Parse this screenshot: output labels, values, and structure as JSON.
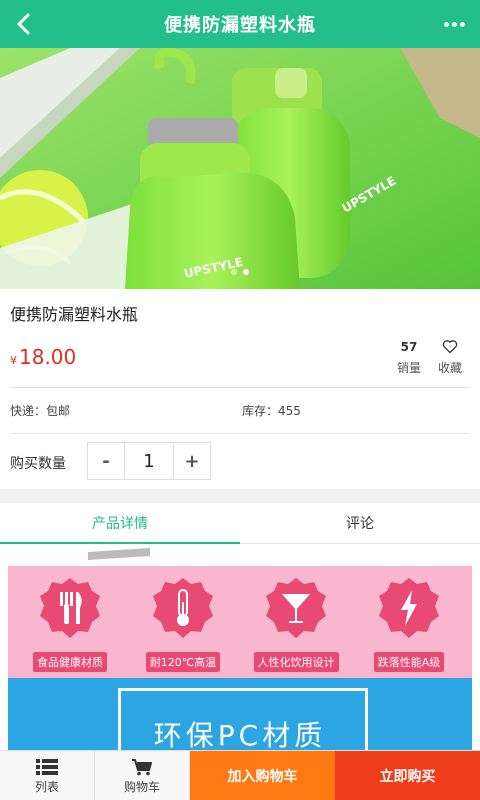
{
  "header": {
    "title": "便携防漏塑料水瓶"
  },
  "hero": {
    "bottle_text": "UPSTYLE",
    "slide_count": 2,
    "active_slide": 2
  },
  "product": {
    "name": "便携防漏塑料水瓶",
    "currency": "¥",
    "price": "18.00",
    "sales_count": "57",
    "sales_label": "销量",
    "favorite_label": "收藏",
    "shipping": "快递：包邮",
    "stock": "库存：455",
    "quantity_label": "购买数量",
    "quantity": "1",
    "minus": "-",
    "plus": "+"
  },
  "tabs": [
    {
      "label": "产品详情",
      "active": true
    },
    {
      "label": "评论",
      "active": false
    }
  ],
  "detail": {
    "features": [
      {
        "icon": "utensils-icon",
        "caption": "食品健康材质"
      },
      {
        "icon": "thermometer-icon",
        "caption": "耐120℃高温"
      },
      {
        "icon": "cocktail-icon",
        "caption": "人性化饮用设计"
      },
      {
        "icon": "lightning-icon",
        "caption": "跌落性能A级"
      }
    ],
    "banner_title": "环保PC材质"
  },
  "bottom_bar": {
    "list_label": "列表",
    "cart_label": "购物车",
    "add_to_cart": "加入购物车",
    "buy_now": "立即购买"
  },
  "colors": {
    "header": "#22bf8a",
    "price": "#e02e24",
    "add_to_cart": "#ff7a14",
    "buy_now": "#ef3d1c",
    "feature_bg": "#f9b7cf",
    "banner_bg": "#2ba6e3"
  }
}
